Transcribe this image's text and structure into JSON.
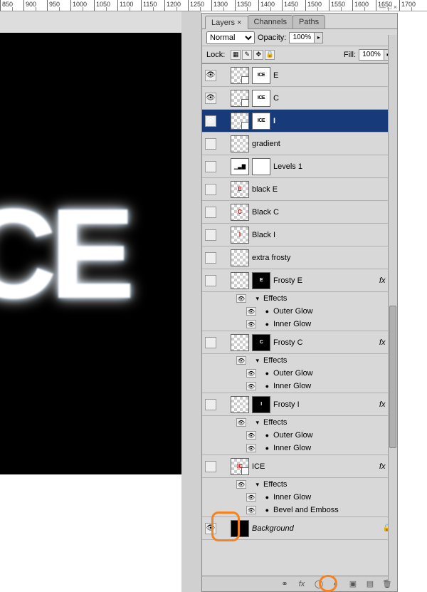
{
  "ruler_ticks": [
    "850",
    "900",
    "950",
    "1000",
    "1050",
    "1100",
    "1150",
    "1200",
    "1250",
    "1300",
    "1350",
    "1400",
    "1450",
    "1500",
    "1550",
    "1600",
    "1650",
    "1700"
  ],
  "canvas_text": "CE",
  "panel": {
    "tabs": [
      "Layers ×",
      "Channels",
      "Paths"
    ],
    "active_tab": 0,
    "blend_mode": "Normal",
    "opacity_label": "Opacity:",
    "opacity_value": "100%",
    "lock_label": "Lock:",
    "fill_label": "Fill:",
    "fill_value": "100%"
  },
  "layers": [
    {
      "visible": true,
      "kind": "smart",
      "mask": "ICE",
      "label": "E"
    },
    {
      "visible": true,
      "kind": "smart",
      "mask": "ICE",
      "label": "C"
    },
    {
      "visible": true,
      "kind": "smart",
      "mask": "ICE",
      "label": "I",
      "selected": true
    },
    {
      "visible": false,
      "kind": "trans",
      "label": "gradient"
    },
    {
      "visible": false,
      "kind": "levels",
      "mask": true,
      "label": "Levels 1"
    },
    {
      "visible": false,
      "kind": "trans",
      "letter": "E",
      "lettercolor": "#d00",
      "label": "black E"
    },
    {
      "visible": false,
      "kind": "trans",
      "letter": "C",
      "lettercolor": "#d00",
      "label": "Black C"
    },
    {
      "visible": false,
      "kind": "trans",
      "letter": "I",
      "lettercolor": "#d00",
      "label": "Black I"
    },
    {
      "visible": false,
      "kind": "trans",
      "label": "extra frosty"
    },
    {
      "visible": false,
      "kind": "trans",
      "mask_letter": "E",
      "label": "Frosty E",
      "fx": true,
      "effects": [
        "Outer Glow",
        "Inner Glow"
      ]
    },
    {
      "visible": false,
      "kind": "trans",
      "mask_letter": "C",
      "label": "Frosty C",
      "fx": true,
      "effects": [
        "Outer Glow",
        "Inner Glow"
      ]
    },
    {
      "visible": false,
      "kind": "trans",
      "mask_letter": "I",
      "label": "Frosty I",
      "fx": true,
      "effects": [
        "Outer Glow",
        "Inner Glow"
      ]
    },
    {
      "visible": false,
      "kind": "smart",
      "letter": "IC",
      "lettercolor": "#d00",
      "label": "ICE",
      "fx": true,
      "effects": [
        "Inner Glow",
        "Bevel and Emboss"
      ]
    },
    {
      "visible": true,
      "kind": "solid-black",
      "label": "Background",
      "italic": true,
      "locked": true
    }
  ],
  "effects_heading": "Effects",
  "footer_icons": [
    "link",
    "fx",
    "mask",
    "adjust",
    "group",
    "new",
    "trash"
  ],
  "panel_close": "— □ ×"
}
